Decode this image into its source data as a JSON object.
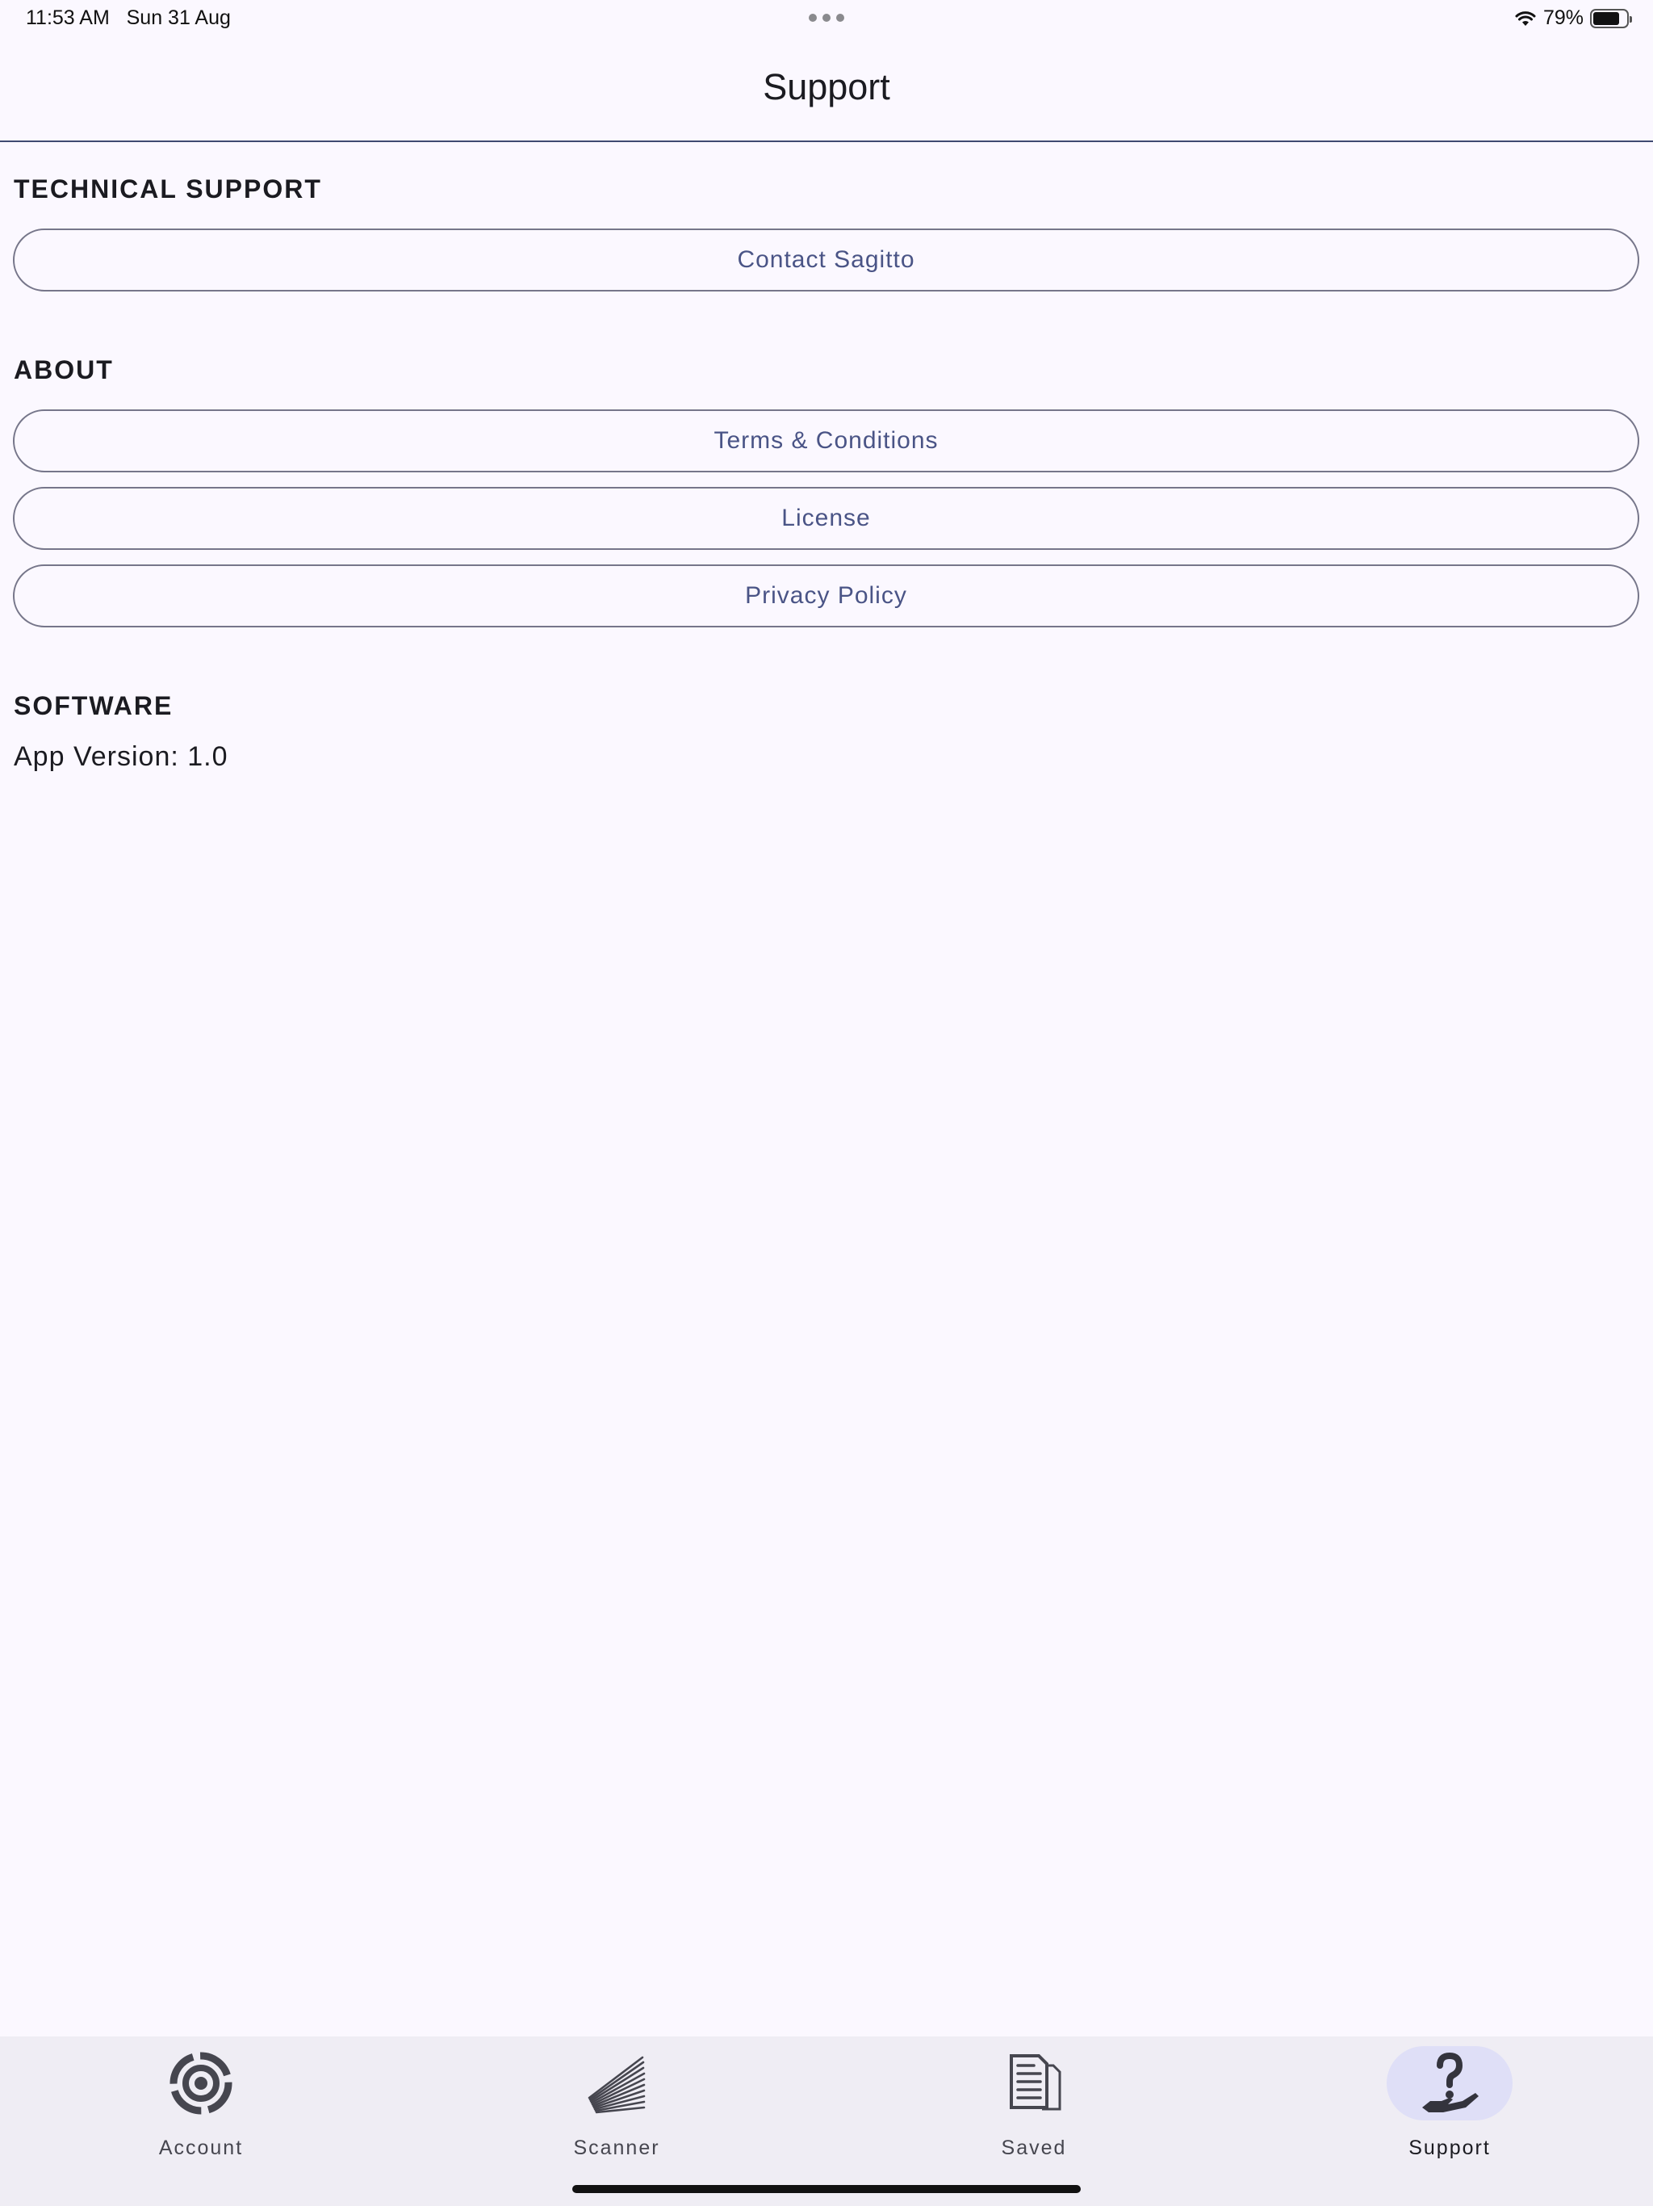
{
  "status_bar": {
    "time": "11:53 AM",
    "date": "Sun 31 Aug",
    "battery_percent": "79%",
    "battery_level": 0.79,
    "icons": [
      "wifi-icon",
      "battery-icon"
    ]
  },
  "app_bar": {
    "title": "Support"
  },
  "sections": {
    "technical_support": {
      "header": "TECHNICAL SUPPORT",
      "buttons": [
        "Contact Sagitto"
      ]
    },
    "about": {
      "header": "ABOUT",
      "buttons": [
        "Terms & Conditions",
        "License",
        "Privacy Policy"
      ]
    },
    "software": {
      "header": "SOFTWARE",
      "version_text": "App Version: 1.0"
    }
  },
  "tab_bar": {
    "tabs": [
      {
        "label": "Account",
        "icon": "account-target-icon",
        "active": false
      },
      {
        "label": "Scanner",
        "icon": "scanner-rays-icon",
        "active": false
      },
      {
        "label": "Saved",
        "icon": "saved-documents-icon",
        "active": false
      },
      {
        "label": "Support",
        "icon": "help-hand-icon",
        "active": true
      }
    ]
  },
  "colors": {
    "background": "#fbf8ff",
    "accent": "#4a5486",
    "tabbar_background": "#efedf4",
    "active_tab_indicator": "#dfdff7",
    "divider": "#3f4a72"
  }
}
